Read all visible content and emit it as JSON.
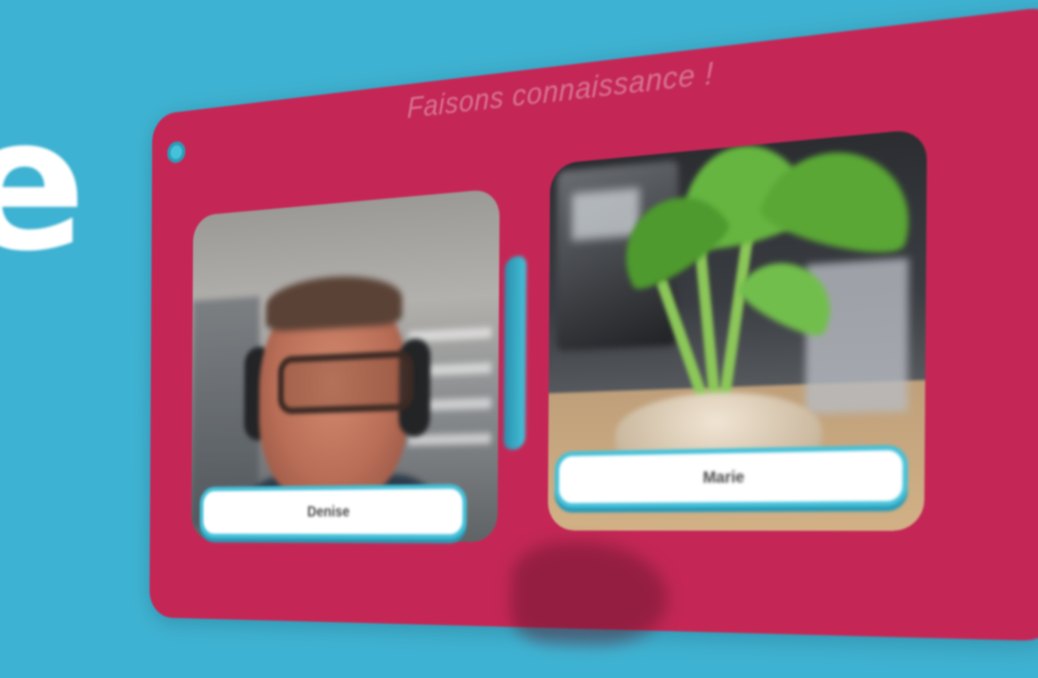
{
  "scene": {
    "background_color": "#3eb2d2",
    "big_letter": "e"
  },
  "card": {
    "title": "Faisons connaissance !",
    "color": "#c42756",
    "accent_color": "#45c1d9"
  },
  "participants": [
    {
      "name": "Denise",
      "video": "person-with-headphones"
    },
    {
      "name": "Marie",
      "video": "potted-plant-on-desk"
    }
  ]
}
